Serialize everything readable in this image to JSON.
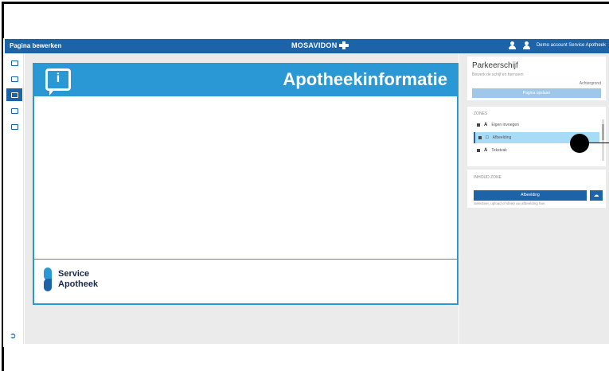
{
  "topbar": {
    "title": "Pagina bewerken",
    "brand": "MOSAVIDON",
    "account": "Demo account Service Apotheek"
  },
  "slide": {
    "title": "Apotheekinformatie",
    "info_glyph": "i",
    "logo_line1": "Service",
    "logo_line2": "Apotheek"
  },
  "panel": {
    "card_title": "Parkeerschijf",
    "card_subtitle": "Bewerk de schijf en hernoem",
    "card_small": "Achtergrond",
    "card_button": "Pagina opslaan",
    "zones_header": "ZONES",
    "zones": [
      {
        "label": "Eigen invoegen",
        "type": "A"
      },
      {
        "label": "Afbeelding",
        "type": "img"
      },
      {
        "label": "Tekstvak",
        "type": "A"
      }
    ],
    "content_header": "INHOUD ZONE",
    "content_button": "Afbeelding",
    "content_note": "Selecteer, upload of sleep uw afbeelding hier"
  },
  "colors": {
    "accent": "#1c63a8",
    "slide_blue": "#2a98d4",
    "selection": "#a8dcf6"
  }
}
